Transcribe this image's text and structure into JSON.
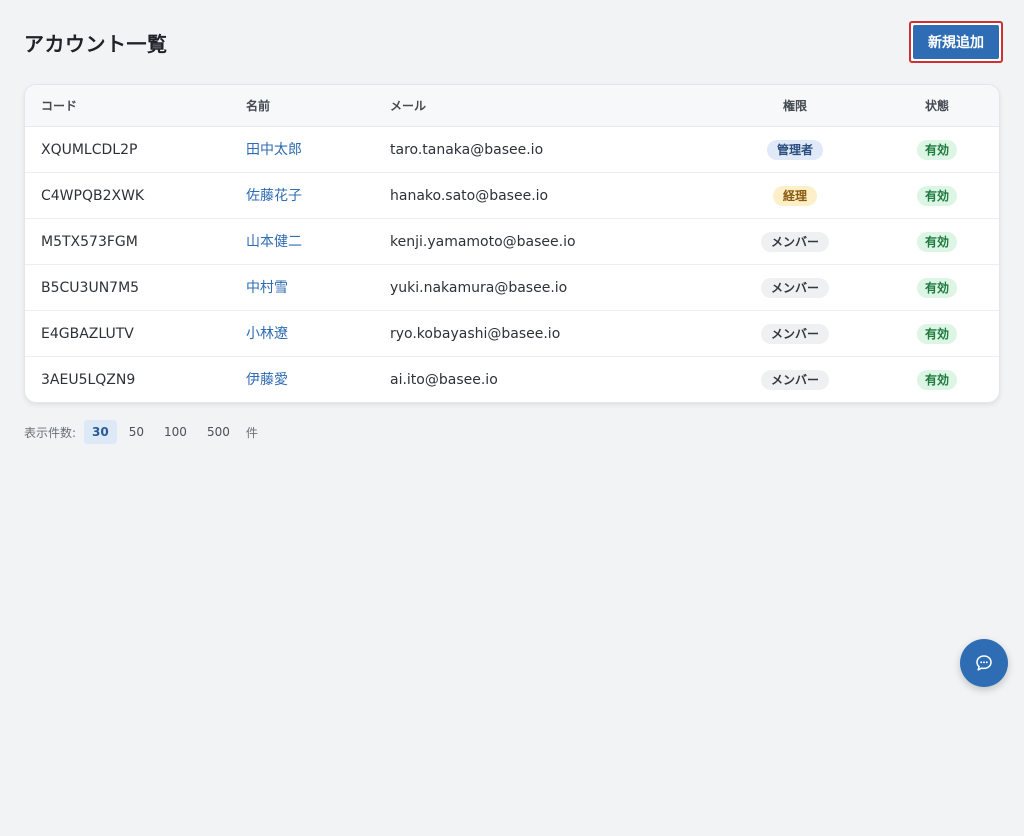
{
  "header": {
    "title": "アカウント一覧",
    "add_button_label": "新規追加"
  },
  "table": {
    "columns": {
      "code": "コード",
      "name": "名前",
      "mail": "メール",
      "role": "権限",
      "status": "状態"
    },
    "rows": [
      {
        "code": "XQUMLCDL2P",
        "name": "田中太郎",
        "mail": "taro.tanaka@basee.io",
        "role": "管理者",
        "role_type": "admin",
        "status": "有効"
      },
      {
        "code": "C4WPQB2XWK",
        "name": "佐藤花子",
        "mail": "hanako.sato@basee.io",
        "role": "経理",
        "role_type": "acct",
        "status": "有効"
      },
      {
        "code": "M5TX573FGM",
        "name": "山本健二",
        "mail": "kenji.yamamoto@basee.io",
        "role": "メンバー",
        "role_type": "member",
        "status": "有効"
      },
      {
        "code": "B5CU3UN7M5",
        "name": "中村雪",
        "mail": "yuki.nakamura@basee.io",
        "role": "メンバー",
        "role_type": "member",
        "status": "有効"
      },
      {
        "code": "E4GBAZLUTV",
        "name": "小林遼",
        "mail": "ryo.kobayashi@basee.io",
        "role": "メンバー",
        "role_type": "member",
        "status": "有効"
      },
      {
        "code": "3AEU5LQZN9",
        "name": "伊藤愛",
        "mail": "ai.ito@basee.io",
        "role": "メンバー",
        "role_type": "member",
        "status": "有効"
      }
    ]
  },
  "pager": {
    "label": "表示件数:",
    "options": [
      "30",
      "50",
      "100",
      "500"
    ],
    "selected": "30",
    "unit": "件"
  },
  "chat": {
    "icon": "chat-bubble-icon"
  },
  "colors": {
    "accent": "#2e6db4",
    "highlight_border": "#d0302f"
  }
}
